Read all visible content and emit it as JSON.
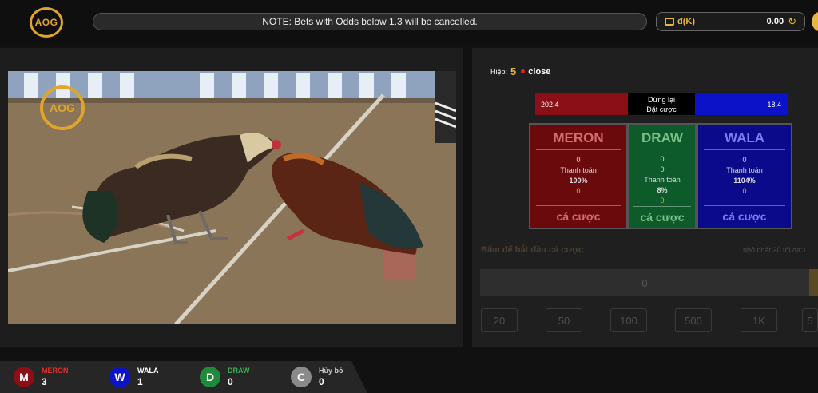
{
  "header": {
    "logo_text": "AOG",
    "notice": "NOTE: Bets with Odds below 1.3 will be cancelled.",
    "currency": "đ(K)",
    "balance": "0.00",
    "icons": [
      "wallet-icon",
      "refresh-icon"
    ]
  },
  "video": {
    "watermark": "AOG"
  },
  "round": {
    "label": "Hiệp:",
    "number": "5",
    "status": "close"
  },
  "odds": {
    "meron_total": "202.4",
    "status_line1": "Dừng lại",
    "status_line2": "Đặt cược",
    "wala_total": "18.4"
  },
  "cards": {
    "meron": {
      "title": "MERON",
      "amount": "0",
      "payout_label": "Thanh toán",
      "payout_pct": "100%",
      "my_bet": "0",
      "bet_label": "cá cược"
    },
    "draw": {
      "title": "DRAW",
      "amount": "0",
      "amount2": "0",
      "payout_label": "Thanh toán",
      "payout_pct": "8%",
      "my_bet": "0",
      "bet_label": "cá cược"
    },
    "wala": {
      "title": "WALA",
      "amount": "0",
      "payout_label": "Thanh toán",
      "payout_pct": "1104%",
      "my_bet": "0",
      "bet_label": "cá cược"
    }
  },
  "bet_form": {
    "start_hint": "Bấm để bắt đầu cá cược",
    "limits": "nhỏ nhất:20   tối đa:1",
    "input_value": "0",
    "chips": [
      "20",
      "50",
      "100",
      "500",
      "1K",
      "5"
    ]
  },
  "results": [
    {
      "letter": "M",
      "label": "MERON",
      "count": "3",
      "color": "#8b0f16",
      "label_color": "#e03030"
    },
    {
      "letter": "W",
      "label": "WALA",
      "count": "1",
      "color": "#0c12c7",
      "label_color": "#ffffff"
    },
    {
      "letter": "D",
      "label": "DRAW",
      "count": "0",
      "color": "#1f8a3a",
      "label_color": "#3ab04e"
    },
    {
      "letter": "C",
      "label": "Hủy bỏ",
      "count": "0",
      "color": "#8a8a8a",
      "label_color": "#cccccc"
    }
  ]
}
